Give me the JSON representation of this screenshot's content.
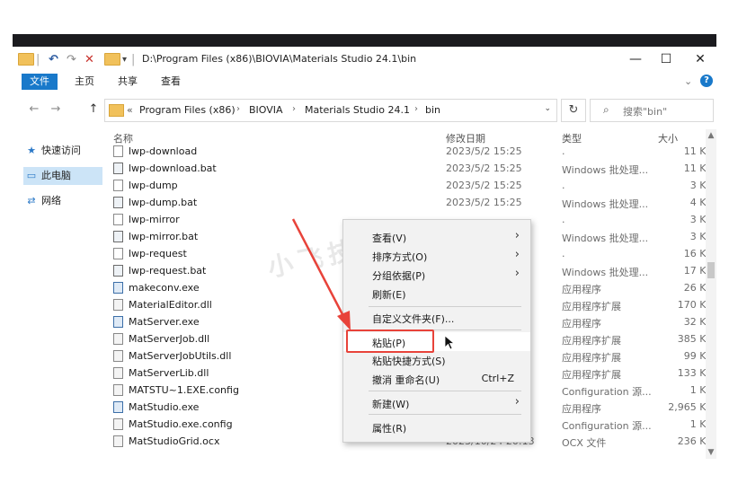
{
  "titlebar": {
    "path": "D:\\Program Files (x86)\\BIOVIA\\Materials Studio 24.1\\bin",
    "minimize": "—",
    "maximize": "☐",
    "close": "✕",
    "qat_sep": "|",
    "qat_undo": "↶",
    "qat_redo": "↷",
    "qat_delete": "✕",
    "qat_dropdown": "▾"
  },
  "ribbon": {
    "tabs": [
      "文件",
      "主页",
      "共享",
      "查看"
    ],
    "expand_icon": "⌄",
    "help_icon": "?"
  },
  "address": {
    "back": "←",
    "forward": "→",
    "up": "↑",
    "prefix": "«",
    "crumbs": [
      "Program Files (x86)",
      "BIOVIA",
      "Materials Studio 24.1",
      "bin"
    ],
    "sep": "›",
    "dropdown": "⌄",
    "refresh": "↻",
    "search_icon": "⌕",
    "search_placeholder": "搜索\"bin\""
  },
  "nav": {
    "items": [
      {
        "icon": "★",
        "label": "快速访问"
      },
      {
        "icon": "▭",
        "label": "此电脑"
      },
      {
        "icon": "⇄",
        "label": "网络"
      }
    ]
  },
  "columns": {
    "name": "名称",
    "date": "修改日期",
    "type": "类型",
    "size": "大小",
    "sort_arrow": "^"
  },
  "files": [
    {
      "name": "lwp-download",
      "date": "2023/5/2 15:25",
      "type": ".",
      "size": "11 KB",
      "icon": "file"
    },
    {
      "name": "lwp-download.bat",
      "date": "2023/5/2 15:25",
      "type": "Windows 批处理...",
      "size": "11 KB",
      "icon": "bat"
    },
    {
      "name": "lwp-dump",
      "date": "2023/5/2 15:25",
      "type": ".",
      "size": "3 KB",
      "icon": "file"
    },
    {
      "name": "lwp-dump.bat",
      "date": "2023/5/2 15:25",
      "type": "Windows 批处理...",
      "size": "4 KB",
      "icon": "bat"
    },
    {
      "name": "lwp-mirror",
      "date": "",
      "type": ".",
      "size": "3 KB",
      "icon": "file"
    },
    {
      "name": "lwp-mirror.bat",
      "date": "",
      "type": "Windows 批处理...",
      "size": "3 KB",
      "icon": "bat"
    },
    {
      "name": "lwp-request",
      "date": "",
      "type": ".",
      "size": "16 KB",
      "icon": "file"
    },
    {
      "name": "lwp-request.bat",
      "date": "",
      "type": "Windows 批处理...",
      "size": "17 KB",
      "icon": "bat"
    },
    {
      "name": "makeconv.exe",
      "date": "",
      "type": "应用程序",
      "size": "26 KB",
      "icon": "exe"
    },
    {
      "name": "MaterialEditor.dll",
      "date": "",
      "type": "应用程序扩展",
      "size": "170 KB",
      "icon": "gear"
    },
    {
      "name": "MatServer.exe",
      "date": "",
      "type": "应用程序",
      "size": "32 KB",
      "icon": "exe"
    },
    {
      "name": "MatServerJob.dll",
      "date": "",
      "type": "应用程序扩展",
      "size": "385 KB",
      "icon": "gear"
    },
    {
      "name": "MatServerJobUtils.dll",
      "date": "",
      "type": "应用程序扩展",
      "size": "99 KB",
      "icon": "gear"
    },
    {
      "name": "MatServerLib.dll",
      "date": "",
      "type": "应用程序扩展",
      "size": "133 KB",
      "icon": "gear"
    },
    {
      "name": "MATSTU~1.EXE.config",
      "date": "",
      "type": "Configuration 源...",
      "size": "1 KB",
      "icon": "gear"
    },
    {
      "name": "MatStudio.exe",
      "date": "",
      "type": "应用程序",
      "size": "2,965 KB",
      "icon": "exe"
    },
    {
      "name": "MatStudio.exe.config",
      "date": "",
      "type": "Configuration 源...",
      "size": "1 KB",
      "icon": "gear"
    },
    {
      "name": "MatStudioGrid.ocx",
      "date": "2023/10/24 20:13",
      "type": "OCX 文件",
      "size": "236 KB",
      "icon": "gear"
    }
  ],
  "context_menu": {
    "items": [
      {
        "label": "查看(V)",
        "arrow": "›",
        "shortcut": ""
      },
      {
        "label": "排序方式(O)",
        "arrow": "›",
        "shortcut": ""
      },
      {
        "label": "分组依据(P)",
        "arrow": "›",
        "shortcut": ""
      },
      {
        "label": "刷新(E)",
        "arrow": "",
        "shortcut": ""
      },
      {
        "label": "自定义文件夹(F)...",
        "arrow": "",
        "shortcut": ""
      },
      {
        "label": "粘贴(P)",
        "arrow": "",
        "shortcut": ""
      },
      {
        "label": "粘贴快捷方式(S)",
        "arrow": "",
        "shortcut": ""
      },
      {
        "label": "撤消 重命名(U)",
        "arrow": "",
        "shortcut": "Ctrl+Z"
      },
      {
        "label": "新建(W)",
        "arrow": "›",
        "shortcut": ""
      },
      {
        "label": "属性(R)",
        "arrow": "",
        "shortcut": ""
      }
    ]
  },
  "scroll": {
    "up": "▲",
    "down": "▼"
  },
  "watermark": "小飞技 快餐",
  "colors": {
    "accent": "#1979ca",
    "highlight_box": "#e8433a",
    "nav_selected": "#cce4f7",
    "menu_bg": "#f2f2f2"
  }
}
